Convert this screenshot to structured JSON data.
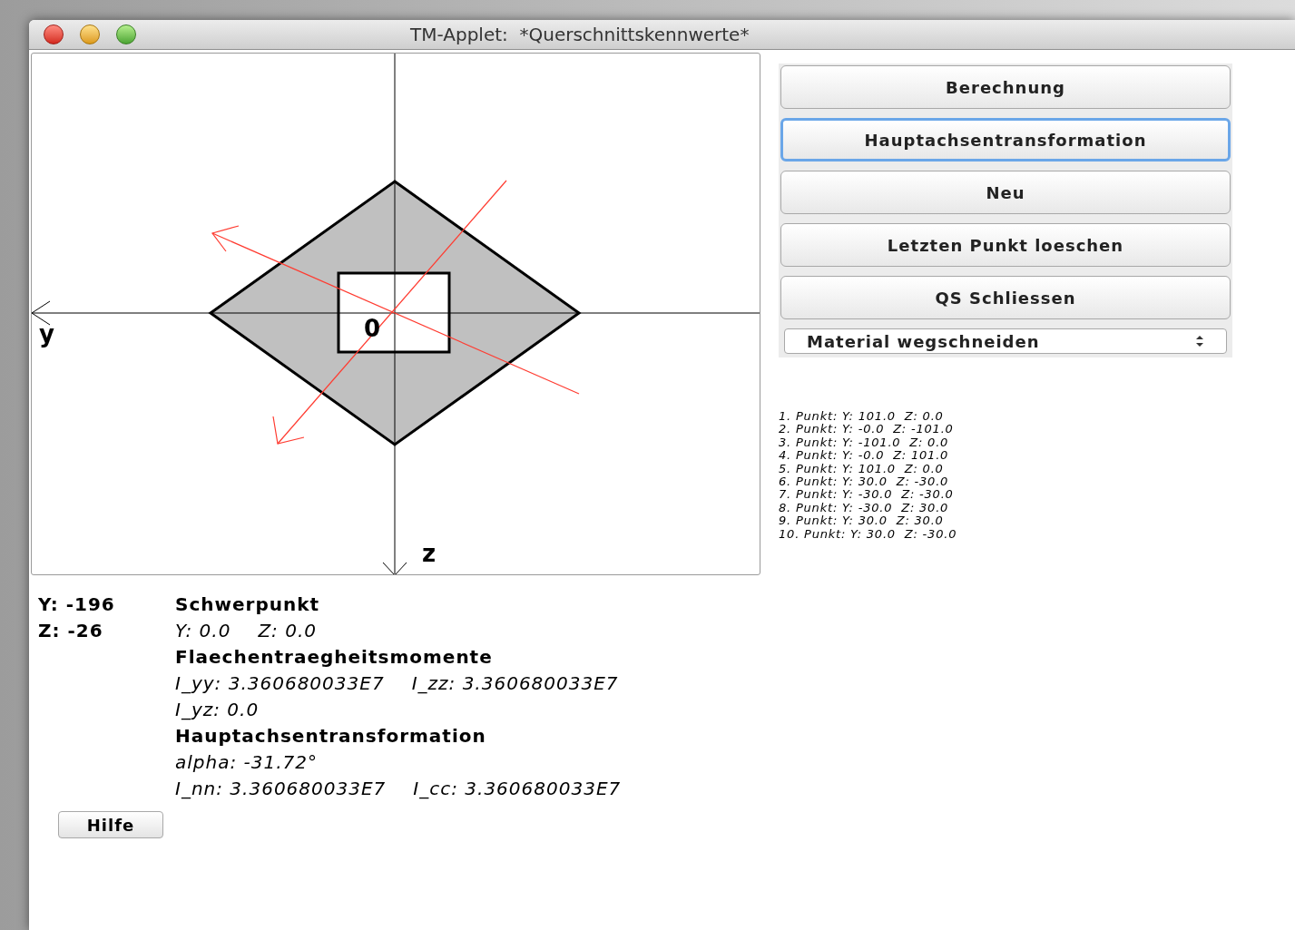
{
  "window": {
    "title": "TM-Applet:  *Querschnittskennwerte*"
  },
  "canvas": {
    "y_axis_label": "y",
    "z_axis_label": "z",
    "origin_label": "0"
  },
  "buttons": [
    {
      "label": "Berechnung",
      "focused": false
    },
    {
      "label": "Hauptachsentransformation",
      "focused": true
    },
    {
      "label": "Neu",
      "focused": false
    },
    {
      "label": "Letzten Punkt loeschen",
      "focused": false
    },
    {
      "label": "QS Schliessen",
      "focused": false
    }
  ],
  "mode_select": {
    "value": "Material wegschneiden"
  },
  "points": [
    "1. Punkt: Y: 101.0  Z: 0.0",
    "2. Punkt: Y: -0.0  Z: -101.0",
    "3. Punkt: Y: -101.0  Z: 0.0",
    "4. Punkt: Y: -0.0  Z: 101.0",
    "5. Punkt: Y: 101.0  Z: 0.0",
    "6. Punkt: Y: 30.0  Z: -30.0",
    "7. Punkt: Y: -30.0  Z: -30.0",
    "8. Punkt: Y: -30.0  Z: 30.0",
    "9. Punkt: Y: 30.0  Z: 30.0",
    "10. Punkt: Y: 30.0  Z: -30.0"
  ],
  "cursor": [
    "Y: -196",
    "Z: -26"
  ],
  "results": [
    {
      "heading": "Schwerpunkt",
      "lines": [
        [
          "Y: 0.0",
          "Z: 0.0"
        ]
      ]
    },
    {
      "heading": "Flaechentraegheitsmomente",
      "lines": [
        [
          "I_yy: 3.360680033E7",
          "I_zz: 3.360680033E7"
        ],
        [
          "I_yz: 0.0"
        ]
      ]
    },
    {
      "heading": "Hauptachsentransformation",
      "lines": [
        [
          "alpha: -31.72°"
        ],
        [
          "I_nn: 3.360680033E7",
          "I_cc: 3.360680033E7"
        ]
      ]
    }
  ],
  "help_button": "Hilfe"
}
